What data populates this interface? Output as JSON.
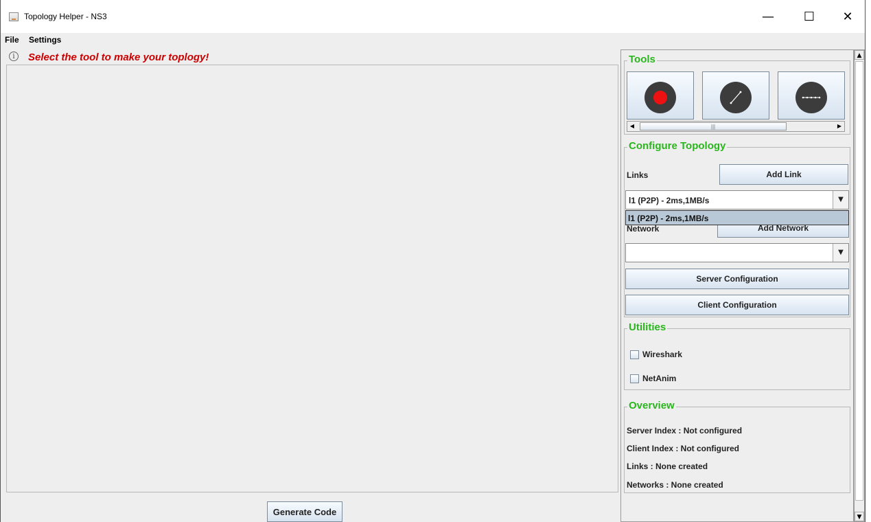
{
  "window": {
    "title": "Topology Helper - NS3"
  },
  "window_controls": {
    "minimize": "—",
    "maximize": "☐",
    "close": "✕"
  },
  "menubar": {
    "file": "File",
    "settings": "Settings"
  },
  "hint": {
    "text": "Select the tool to make your toplogy!",
    "icon": "info-icon",
    "color": "#cc0000"
  },
  "tools": {
    "title": "Tools",
    "items": [
      {
        "icon": "node-tool-icon"
      },
      {
        "icon": "link-tool-icon"
      },
      {
        "icon": "network-tool-icon"
      }
    ]
  },
  "configure": {
    "title": "Configure Topology",
    "links_label": "Links",
    "add_link": "Add Link",
    "links_selected": "l1 (P2P) - 2ms,1MB/s",
    "links_popup_option": "l1 (P2P) - 2ms,1MB/s",
    "network_label": "Network",
    "add_network": "Add Network",
    "network_selected": "",
    "server_config": "Server Configuration",
    "client_config": "Client Configuration"
  },
  "utilities": {
    "title": "Utilities",
    "wireshark": "Wireshark",
    "netanim": "NetAnim"
  },
  "overview": {
    "title": "Overview",
    "server": "Server Index :  Not configured",
    "client": "Client Index  : Not configured",
    "links": "Links :  None created",
    "networks": "Networks : None created"
  },
  "generate": "Generate Code",
  "colors": {
    "accent_green": "#2ab61d",
    "hint_red": "#cc0000",
    "node_red": "#ee1111"
  }
}
